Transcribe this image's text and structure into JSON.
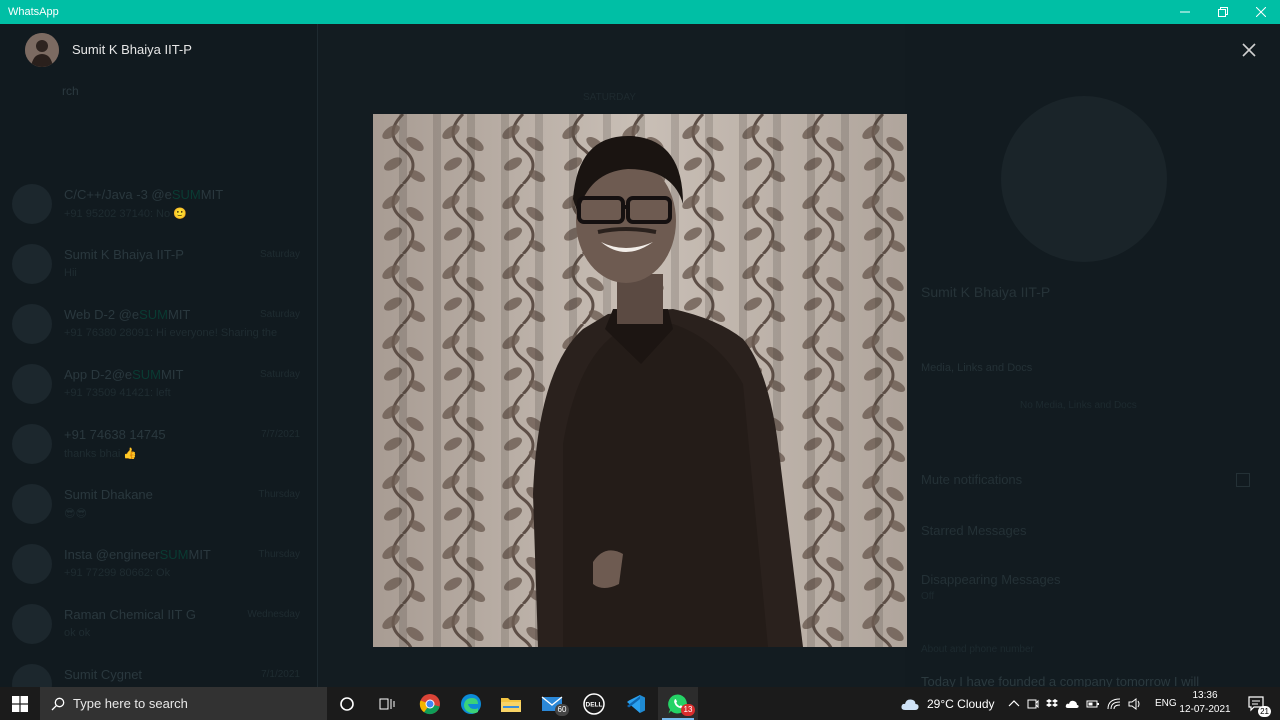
{
  "window": {
    "title": "WhatsApp"
  },
  "background": {
    "search_placeholder": "rch",
    "chats": [
      {
        "name_pre": "C/C++/Java -3 @e",
        "name_hl": "SUM",
        "name_post": "MIT",
        "msg": "+91 95202 37140: No 🙂",
        "time": ""
      },
      {
        "name_pre": "Sumit K Bhaiya IIT-P",
        "name_hl": "",
        "name_post": "",
        "msg": "Hii",
        "time": "Saturday"
      },
      {
        "name_pre": "Web D-2 @e",
        "name_hl": "SUM",
        "name_post": "MIT",
        "msg": "+91 76380 28091: Hi everyone! Sharing the",
        "time": "Saturday"
      },
      {
        "name_pre": "App D-2@e",
        "name_hl": "SUM",
        "name_post": "MIT",
        "msg": "+91 73509 41421: left",
        "time": "Saturday"
      },
      {
        "name_pre": "+91 74638 14745",
        "name_hl": "",
        "name_post": "",
        "msg": "thanks bhai 👍",
        "time": "7/7/2021"
      },
      {
        "name_pre": "Sumit Dhakane",
        "name_hl": "",
        "name_post": "",
        "msg": "😎😎",
        "time": "Thursday"
      },
      {
        "name_pre": "Insta @engineer",
        "name_hl": "SUM",
        "name_post": "MIT",
        "msg": "+91 77299 80662: Ok",
        "time": "Thursday"
      },
      {
        "name_pre": "Raman Chemical IIT G",
        "name_hl": "",
        "name_post": "",
        "msg": "ok ok",
        "time": "Wednesday"
      },
      {
        "name_pre": "Sumit Cygnet",
        "name_hl": "",
        "name_post": "",
        "msg": "",
        "time": "7/1/2021"
      }
    ],
    "date_chip": "SATURDAY",
    "profile": {
      "name": "Sumit K Bhaiya IIT-P",
      "media_label": "Media, Links and Docs",
      "no_media": "No Media, Links and Docs",
      "mute": "Mute notifications",
      "starred": "Starred Messages",
      "disappearing": "Disappearing Messages",
      "disappearing_value": "Off",
      "about_heading": "About and phone number",
      "about": "Today I have founded a company tomorrow I will"
    }
  },
  "viewer": {
    "contact_name": "Sumit K Bhaiya IIT-P",
    "close_icon": "close-icon"
  },
  "taskbar": {
    "search_placeholder": "Type here to search",
    "mail_badge": "60",
    "whatsapp_badge": "13",
    "weather": "29°C  Cloudy",
    "language": "ENG",
    "time": "13:36",
    "date": "12-07-2021",
    "notification_count": "21"
  }
}
